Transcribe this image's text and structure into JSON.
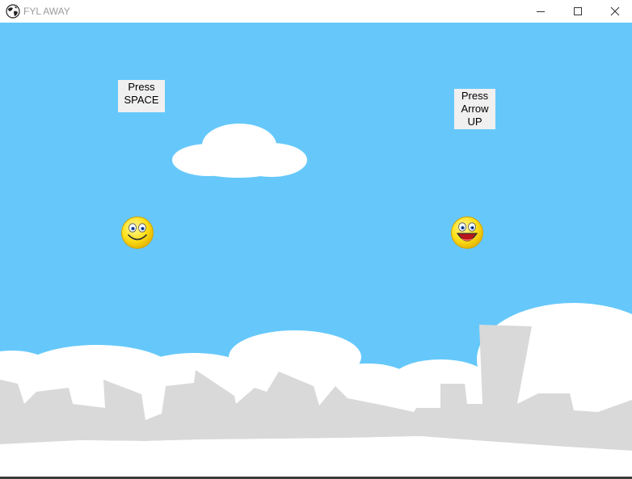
{
  "window": {
    "title": "FYL AWAY",
    "icon": "globe-icon",
    "controls": [
      "minimize-icon",
      "maximize-icon",
      "close-icon"
    ]
  },
  "game": {
    "sky_color": "#66c8fa",
    "player_one": {
      "name": "player-one-smiley",
      "hint_lines": [
        "Press",
        "SPACE"
      ]
    },
    "player_two": {
      "name": "player-two-smiley",
      "hint_lines": [
        "Press",
        "Arrow",
        "UP"
      ]
    }
  }
}
